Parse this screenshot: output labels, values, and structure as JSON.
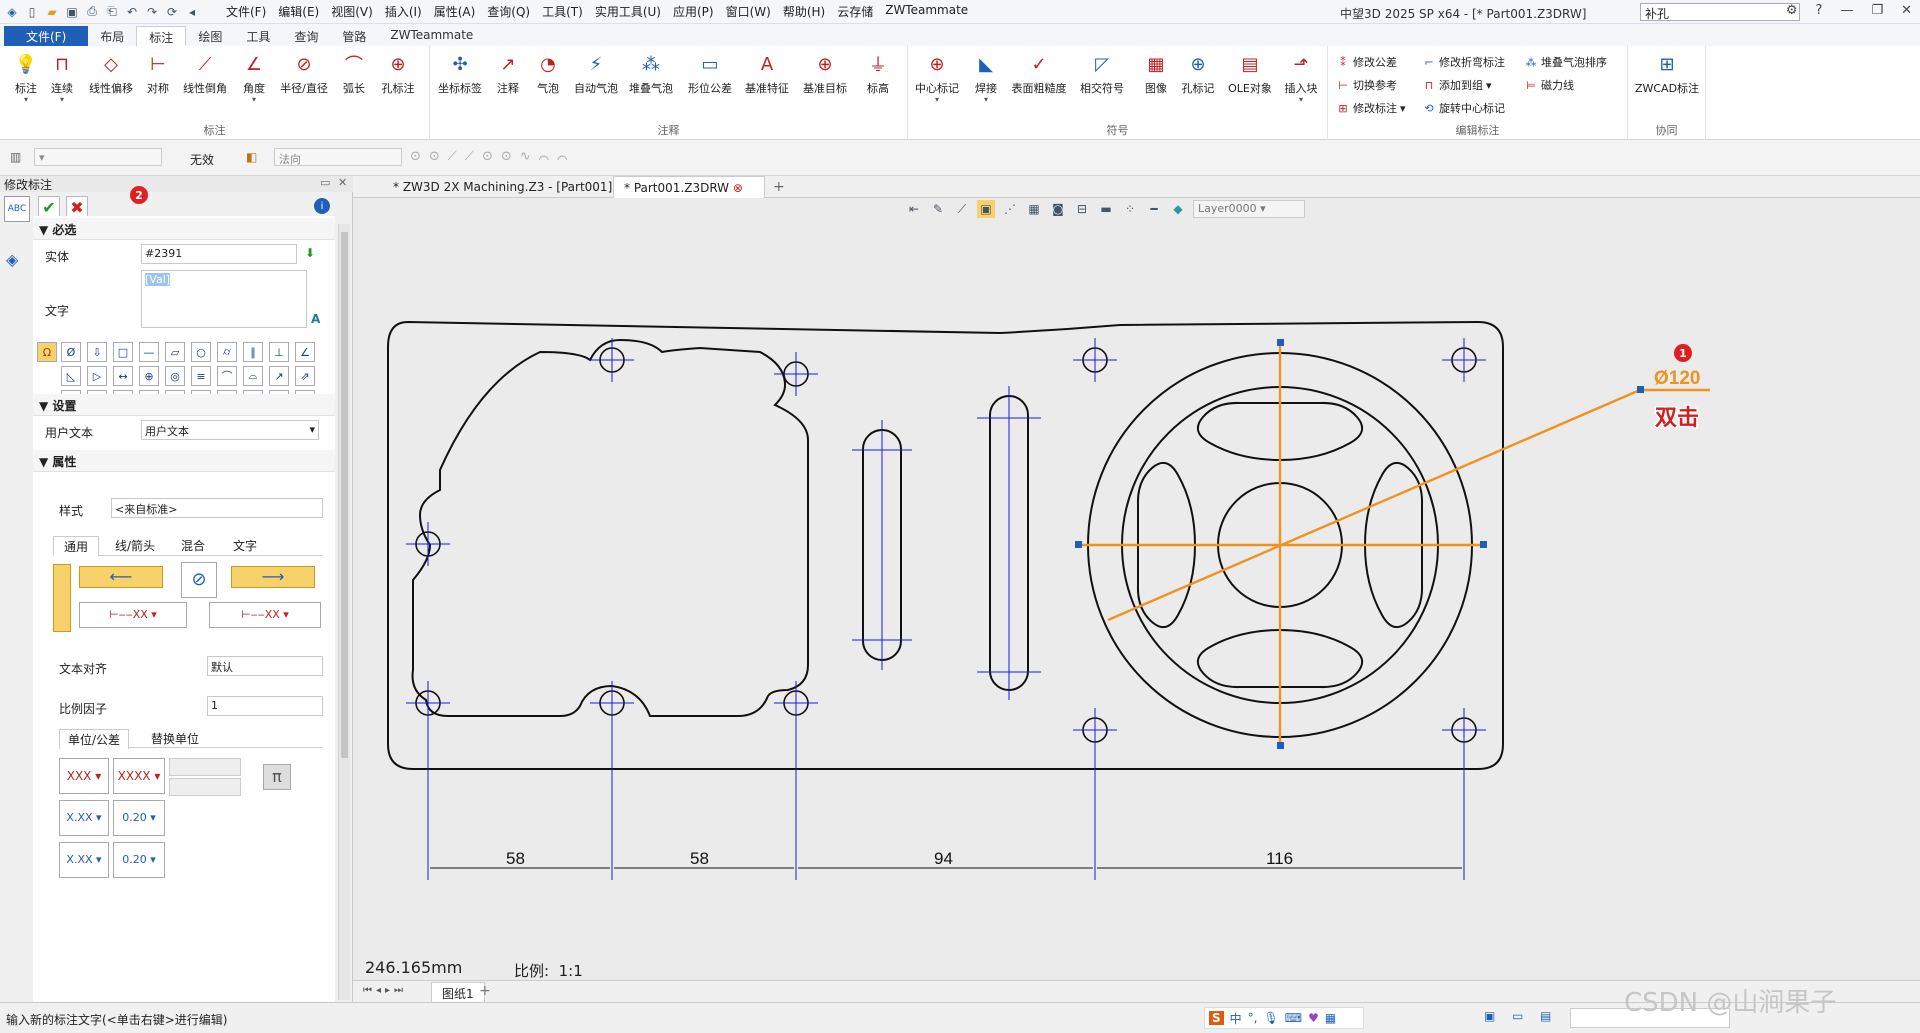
{
  "app": {
    "title": "中望3D 2025 SP x64 - [* Part001.Z3DRW]",
    "menus": [
      "文件(F)",
      "编辑(E)",
      "视图(V)",
      "插入(I)",
      "属性(A)",
      "查询(Q)",
      "工具(T)",
      "实用工具(U)",
      "应用(P)",
      "窗口(W)",
      "帮助(H)",
      "云存储",
      "ZWTeammate"
    ],
    "search_value": "补孔",
    "window_buttons": [
      "—",
      "❐",
      "✕"
    ]
  },
  "ribbon_tabs": [
    "文件(F)",
    "布局",
    "标注",
    "绘图",
    "工具",
    "查询",
    "管路",
    "ZWTeammate"
  ],
  "ribbon": {
    "groups": {
      "dimension": {
        "name": "标注",
        "buttons": [
          "标注",
          "连续",
          "线性偏移",
          "对称",
          "线性倒角",
          "角度",
          "半径/直径",
          "弧长",
          "孔标注"
        ]
      },
      "annotation": {
        "name": "注释",
        "buttons": [
          "坐标标签",
          "注释",
          "气泡",
          "自动气泡",
          "堆叠气泡",
          "形位公差",
          "基准特征",
          "基准目标",
          "标高"
        ]
      },
      "symbol": {
        "name": "符号",
        "buttons": [
          "中心标记",
          "焊接",
          "表面粗糙度",
          "相交符号",
          "图像",
          "孔标记",
          "OLE对象",
          "插入块"
        ]
      },
      "edit": {
        "name": "编辑标注",
        "col1": [
          "修改公差",
          "切换参考",
          "修改标注"
        ],
        "col2": [
          "修改折弯标注",
          "添加到组",
          "旋转中心标记"
        ],
        "col3": [
          "堆叠气泡排序",
          "磁力线"
        ]
      },
      "collab": {
        "name": "协同",
        "button": "ZWCAD标注"
      }
    }
  },
  "command_bar": {
    "status_label": "无效",
    "direction_placeholder": "法向"
  },
  "panel": {
    "title": "修改标注",
    "sections": {
      "required": "必选",
      "settings": "设置",
      "properties": "属性"
    },
    "entity_label": "实体",
    "entity_value": "#2391",
    "text_label": "文字",
    "text_value": "[Val]",
    "user_text_label": "用户文本",
    "user_text_value": "用户文本",
    "style_label": "样式",
    "style_value": "<来自标准>",
    "prop_tabs": [
      "通用",
      "线/箭头",
      "混合",
      "文字"
    ],
    "text_align_label": "文本对齐",
    "text_align_value": "默认",
    "scale_label": "比例因子",
    "scale_value": "1",
    "unit_tabs": [
      "单位/公差",
      "替换单位"
    ],
    "fmt_xxx": "XXX",
    "fmt_xxxx": "XXXX",
    "fmt_xxx2": "X.XX",
    "fmt_020": "0.20",
    "badge": "2"
  },
  "doc_tabs": [
    "* ZW3D 2X Machining.Z3 - [Part001]",
    "* Part001.Z3DRW"
  ],
  "view_toolbar": {
    "layer": "Layer0000"
  },
  "drawing": {
    "dims": [
      "58",
      "58",
      "94",
      "116"
    ],
    "diameter_label": "Ø120",
    "dblclick_label": "双击",
    "badge": "1"
  },
  "canvas_info": {
    "coord": "246.165mm",
    "scale_label": "比例:",
    "scale_value": "1:1"
  },
  "sheet": {
    "name": "图纸1"
  },
  "status": {
    "prompt": "输入新的标注文字(<单击右键>进行编辑)",
    "ime": "中"
  },
  "watermark": "CSDN @山涧果子",
  "colors": {
    "accent_orange": "#f0921e",
    "file_tab": "#1f5fb8",
    "badge_red": "#e02020"
  }
}
